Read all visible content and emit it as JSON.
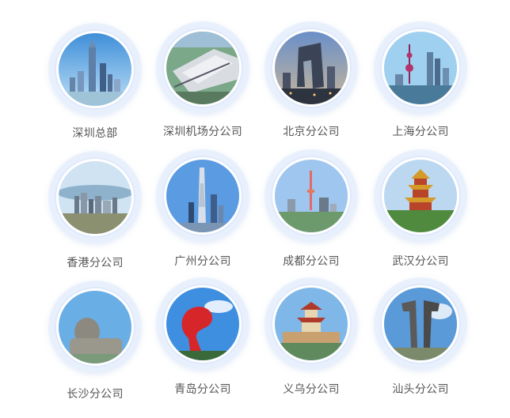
{
  "offices": [
    {
      "name": "深圳总部",
      "icon": "shenzhen-skyline-icon"
    },
    {
      "name": "深圳机场分公司",
      "icon": "airport-building-icon"
    },
    {
      "name": "北京分公司",
      "icon": "cctv-tower-icon"
    },
    {
      "name": "上海分公司",
      "icon": "pearl-tower-skyline-icon"
    },
    {
      "name": "香港分公司",
      "icon": "hongkong-harbor-icon"
    },
    {
      "name": "广州分公司",
      "icon": "canton-tower-icon"
    },
    {
      "name": "成都分公司",
      "icon": "chengdu-tower-icon"
    },
    {
      "name": "武汉分公司",
      "icon": "yellow-crane-tower-icon"
    },
    {
      "name": "长沙分公司",
      "icon": "mao-statue-icon"
    },
    {
      "name": "青岛分公司",
      "icon": "may-fourth-square-icon"
    },
    {
      "name": "义乌分公司",
      "icon": "pagoda-icon"
    },
    {
      "name": "汕头分公司",
      "icon": "monument-sculpture-icon"
    }
  ]
}
